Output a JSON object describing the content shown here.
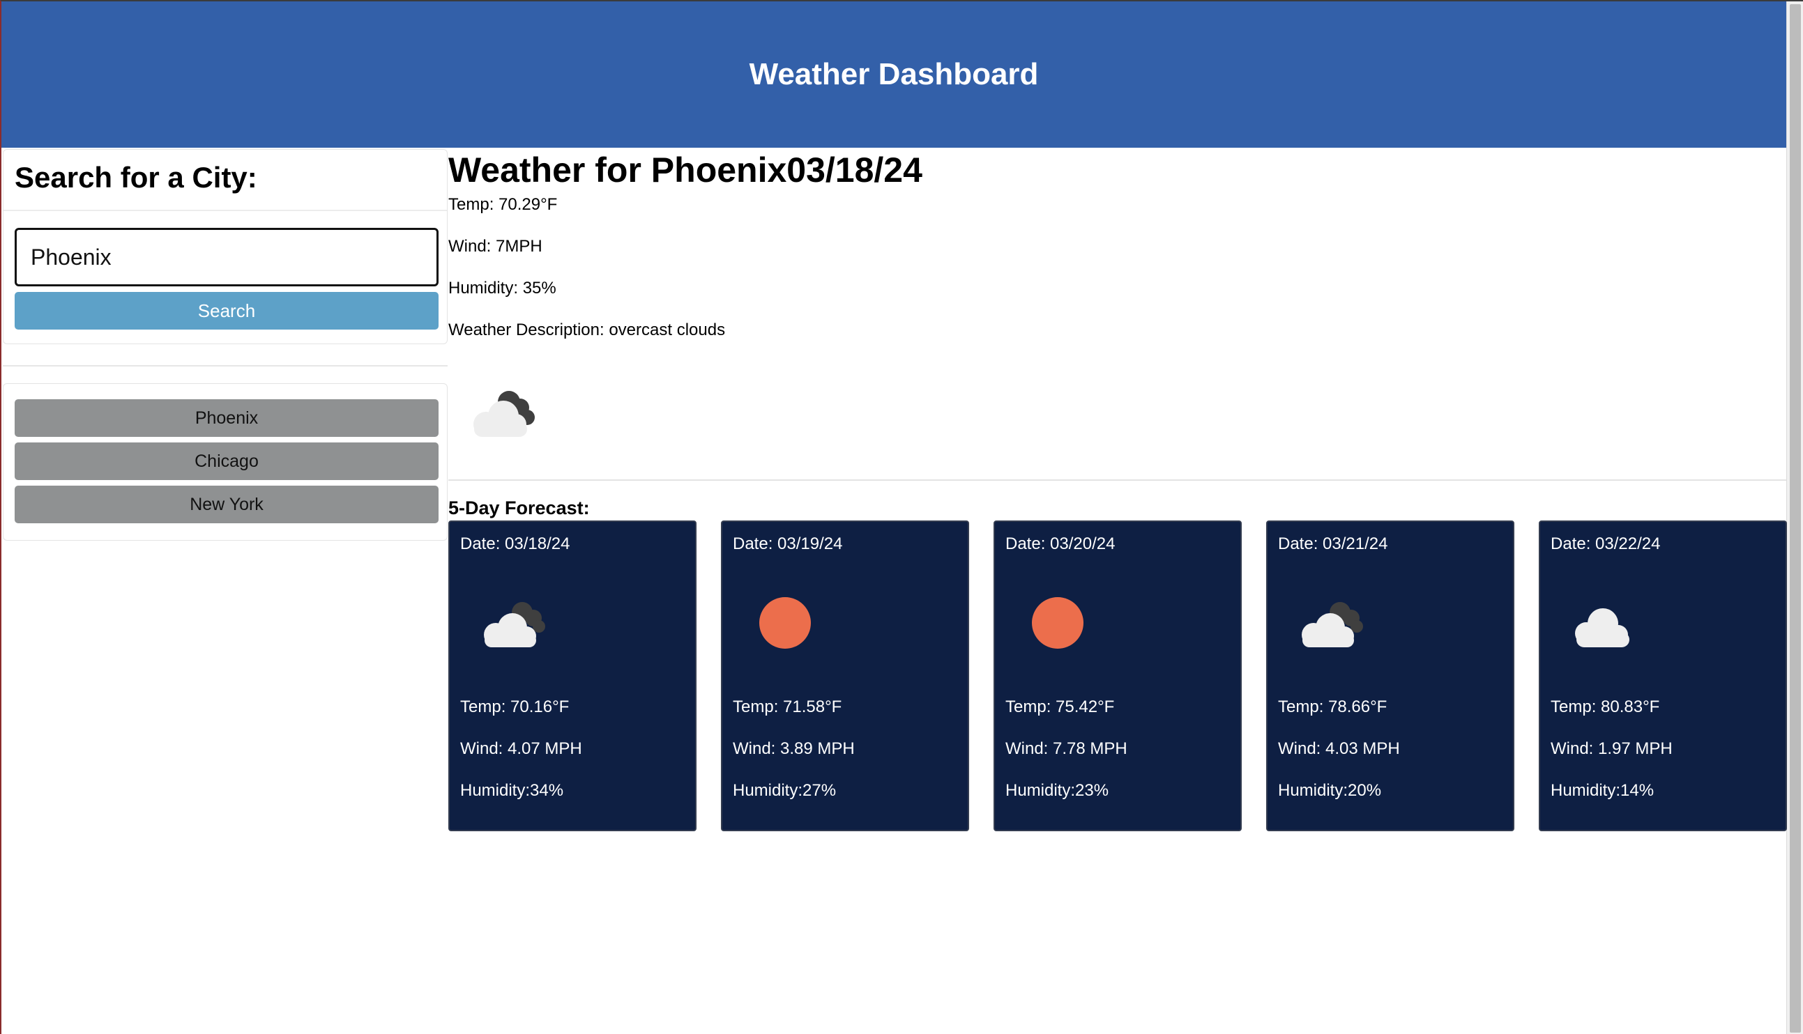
{
  "header": {
    "title": "Weather Dashboard"
  },
  "sidebar": {
    "search_heading": "Search for a City:",
    "search_input_value": "Phoenix",
    "search_button_label": "Search",
    "history": [
      "Phoenix",
      "Chicago",
      "New York"
    ]
  },
  "current": {
    "heading": "Weather for Phoenix03/18/24",
    "temp": "Temp: 70.29°F",
    "wind": "Wind: 7MPH",
    "humidity": "Humidity: 35%",
    "description": "Weather Description: overcast clouds",
    "icon": "overcast-clouds-icon"
  },
  "forecast": {
    "title": "5-Day Forecast:",
    "days": [
      {
        "date": "Date: 03/18/24",
        "icon": "broken-clouds-icon",
        "temp": "Temp: 70.16°F",
        "wind": "Wind: 4.07 MPH",
        "humidity": "Humidity:34%"
      },
      {
        "date": "Date: 03/19/24",
        "icon": "clear-sky-icon",
        "temp": "Temp: 71.58°F",
        "wind": "Wind: 3.89 MPH",
        "humidity": "Humidity:27%"
      },
      {
        "date": "Date: 03/20/24",
        "icon": "clear-sky-icon",
        "temp": "Temp: 75.42°F",
        "wind": "Wind: 7.78 MPH",
        "humidity": "Humidity:23%"
      },
      {
        "date": "Date: 03/21/24",
        "icon": "broken-clouds-icon",
        "temp": "Temp: 78.66°F",
        "wind": "Wind: 4.03 MPH",
        "humidity": "Humidity:20%"
      },
      {
        "date": "Date: 03/22/24",
        "icon": "scattered-clouds-icon",
        "temp": "Temp: 80.83°F",
        "wind": "Wind: 1.97 MPH",
        "humidity": "Humidity:14%"
      }
    ]
  },
  "colors": {
    "header_bg": "#3360a9",
    "search_button": "#5da1c8",
    "history_button": "#8f9192",
    "forecast_card": "#0e1f43",
    "sun": "#ec6e4c"
  }
}
